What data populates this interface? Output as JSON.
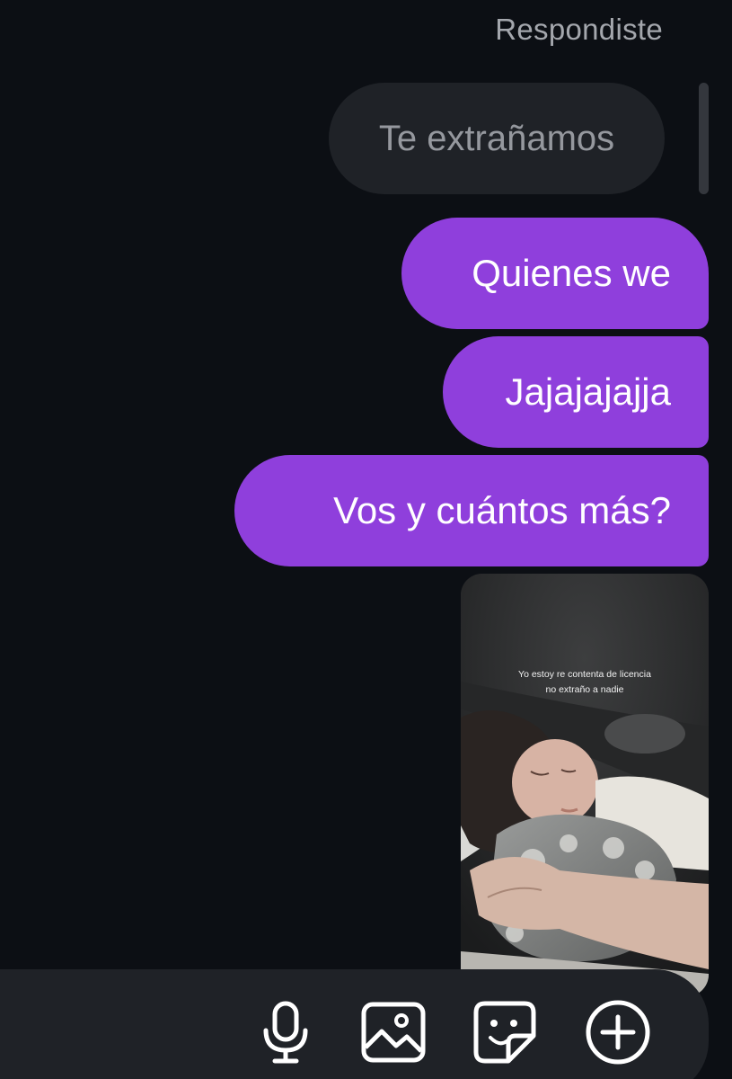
{
  "thread": {
    "replied_label": "Respondiste",
    "quoted_story_text": "Te extrañamos",
    "messages": [
      {
        "text": "Quienes we"
      },
      {
        "text": "Jajajajajja"
      },
      {
        "text": "Vos y cuántos más?"
      }
    ],
    "shared_story": {
      "caption_line1": "Yo estoy re contenta de licencia",
      "caption_line2": "no extraño a nadie"
    }
  },
  "composer": {
    "buttons": [
      {
        "icon": "microphone-icon"
      },
      {
        "icon": "image-icon"
      },
      {
        "icon": "sticker-icon"
      },
      {
        "icon": "plus-circle-icon"
      }
    ]
  },
  "colors": {
    "background": "#0c0f14",
    "sent_bubble": "#8f3fdc",
    "quoted_bubble": "#1f2227",
    "muted_text": "#a4a7ad"
  }
}
